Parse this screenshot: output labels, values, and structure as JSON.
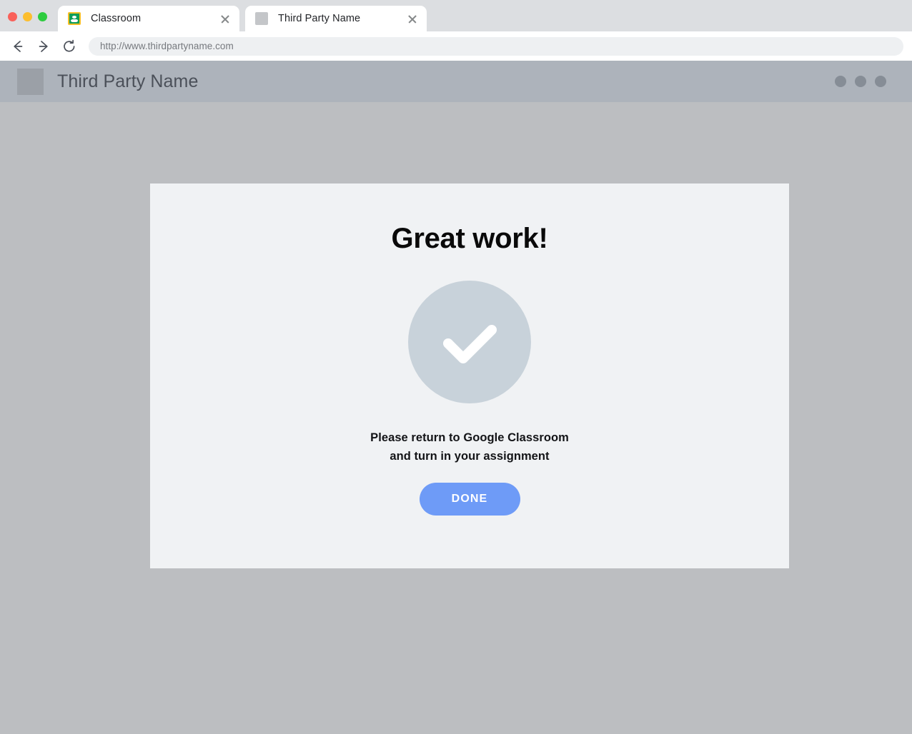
{
  "window": {
    "traffic_lights": [
      {
        "name": "close",
        "color": "#f9615a"
      },
      {
        "name": "minimize",
        "color": "#fcbe2e"
      },
      {
        "name": "maximize",
        "color": "#2dcc3f"
      }
    ]
  },
  "browser": {
    "tabs": [
      {
        "title": "Classroom",
        "favicon": "google-classroom-icon",
        "active": false,
        "close_label": "×"
      },
      {
        "title": "Third Party Name",
        "favicon": "generic-site-icon",
        "active": true,
        "close_label": "×"
      }
    ],
    "toolbar": {
      "back_icon": "arrow-left-icon",
      "forward_icon": "arrow-right-icon",
      "reload_icon": "reload-icon",
      "url": "http://www.thirdpartyname.com"
    }
  },
  "site": {
    "logo_icon": "site-logo-placeholder",
    "title": "Third Party Name",
    "menu_dots": 3
  },
  "card": {
    "heading": "Great work!",
    "status_icon": "checkmark-circle-icon",
    "message_line_1": "Please return to Google Classroom",
    "message_line_2": "and turn in your assignment",
    "done_label": "DONE"
  },
  "colors": {
    "page_background": "#bcbec1",
    "site_header": "#adb3bb",
    "card_background": "#f0f2f4",
    "check_circle": "#c8d2da",
    "check_mark": "#ffffff",
    "done_button": "#6e9bf7",
    "tabstrip": "#dcdee1",
    "omnibox": "#eef0f2"
  }
}
